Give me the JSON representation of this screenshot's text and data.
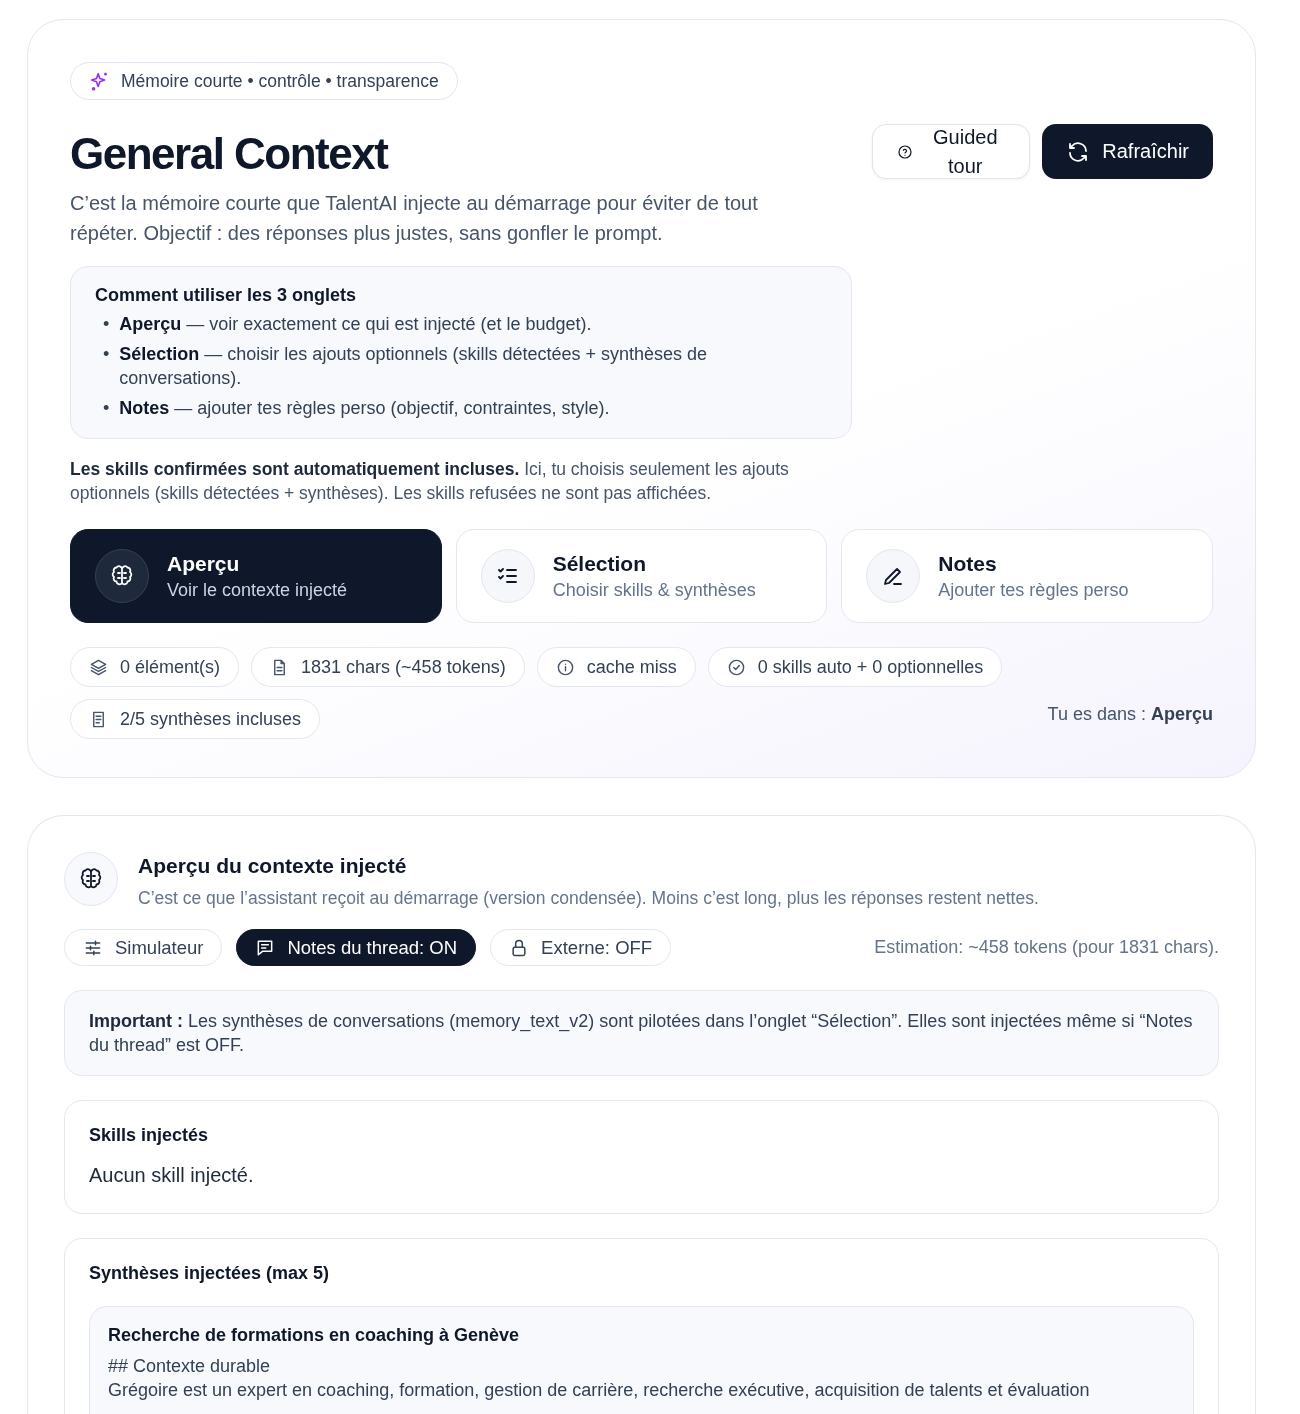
{
  "header": {
    "badge": "Mémoire courte • contrôle • transparence",
    "title": "General Context",
    "description": "C’est la mémoire courte que TalentAI injecte au démarrage pour éviter de tout répéter. Objectif : des réponses plus justes, sans gonfler le prompt.",
    "buttons": [
      {
        "kind": "help",
        "label": "Guided tour"
      },
      {
        "kind": "refresh",
        "label": "Rafraîchir"
      }
    ]
  },
  "howto": {
    "title": "Comment utiliser les 3 onglets",
    "items": [
      {
        "bullet": "•",
        "text": "**Aperçu** — voir exactement ce qui est injecté (et le budget)."
      },
      {
        "bullet": "•",
        "text": "**Sélection** — choisir les ajouts optionnels (skills détectées + synthèses de conversations)."
      },
      {
        "bullet": "•",
        "text": "**Notes** — ajouter tes règles perso (objectif, contraintes, style)."
      }
    ]
  },
  "note": "**Les skills confirmées sont automatiquement incluses.** Ici, tu choisis seulement les ajouts optionnels (skills détectées + synthèses). Les skills refusées ne sont pas affichées.",
  "tabs": [
    {
      "kind": "brain",
      "title": "Aperçu",
      "subtitle": "Voir le contexte injecté",
      "selected": true
    },
    {
      "kind": "checklist",
      "title": "Sélection",
      "subtitle": "Choisir skills & synthèses",
      "selected": false
    },
    {
      "kind": "pencil",
      "title": "Notes",
      "subtitle": "Ajouter tes règles perso",
      "selected": false
    }
  ],
  "chips": [
    {
      "kind": "layers",
      "label": "0 élément(s)"
    },
    {
      "kind": "file",
      "label": "1831 chars (~458 tokens)"
    },
    {
      "kind": "info",
      "label": "cache miss"
    },
    {
      "kind": "check",
      "label": "0 skills auto + 0 optionnelles"
    },
    {
      "kind": "doc",
      "label": "2/5 synthèses incluses"
    }
  ],
  "location": "Tu es dans : **Aperçu**",
  "preview": {
    "title": "Aperçu du contexte injecté",
    "subtitle": "C’est ce que l’assistant reçoit au démarrage (version condensée). Moins c’est long, plus les réponses restent nettes.",
    "toggles": [
      {
        "kind": "sliders",
        "label": "Simulateur",
        "on": false
      },
      {
        "kind": "chat",
        "label": "Notes du thread: ON",
        "on": true
      },
      {
        "kind": "lock",
        "label": "Externe: OFF",
        "on": false
      }
    ],
    "estimate": "Estimation: ~458 tokens (pour 1831 chars).",
    "important": "**Important :** Les synthèses de conversations (memory_text_v2) sont pilotées dans l’onglet “Sélection”. Elles sont injectées même si “Notes du thread” est OFF.",
    "skills": {
      "title": "Skills injectés",
      "empty": "Aucun skill injecté."
    },
    "syntheses": {
      "title": "Synthèses injectées (max 5)",
      "items": [
        {
          "title": "Recherche de formations en coaching à Genève",
          "lines": [
            "## Contexte durable",
            "Grégoire est un expert en coaching, formation, gestion de carrière, recherche exécutive, acquisition de talents et évaluation"
          ]
        }
      ]
    }
  }
}
